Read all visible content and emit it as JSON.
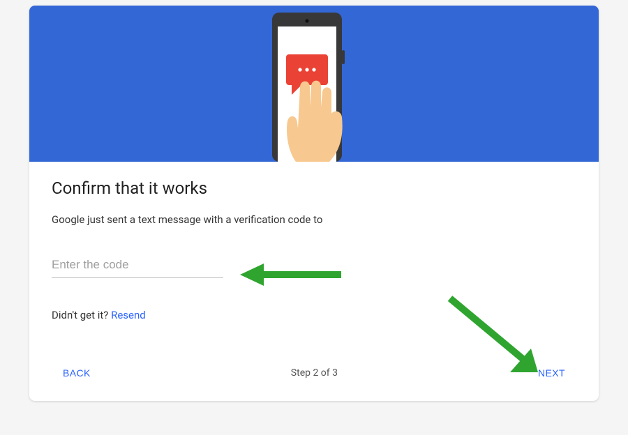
{
  "hero": {
    "icon": "phone-message"
  },
  "title": "Confirm that it works",
  "description": "Google just sent a text message with a verification code to",
  "input": {
    "placeholder": "Enter the code",
    "value": ""
  },
  "resend": {
    "prompt": "Didn't get it? ",
    "link": "Resend"
  },
  "footer": {
    "back": "BACK",
    "step": "Step 2 of 3",
    "next": "NEXT"
  },
  "annotations": [
    {
      "type": "arrow",
      "target": "code-input"
    },
    {
      "type": "arrow",
      "target": "next-button"
    }
  ],
  "colors": {
    "hero": "#3367d6",
    "accent": "#2962ff",
    "arrow": "#2fa52f"
  }
}
